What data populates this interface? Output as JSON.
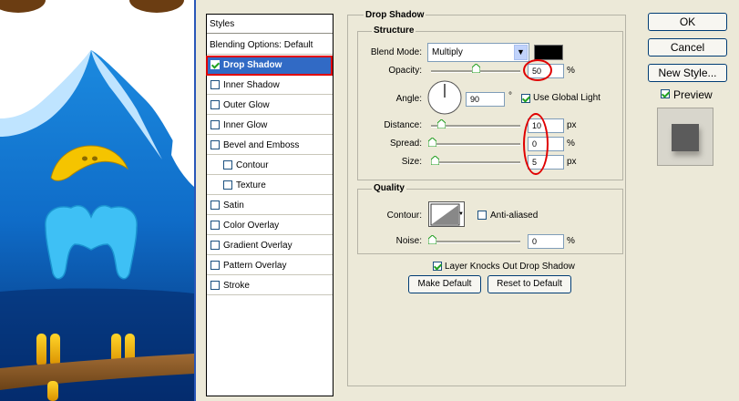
{
  "styles_list": {
    "header": "Styles",
    "items": [
      {
        "label": "Blending Options: Default",
        "has_checkbox": false,
        "checked": false,
        "selected": false,
        "indent": false
      },
      {
        "label": "Drop Shadow",
        "has_checkbox": true,
        "checked": true,
        "selected": true,
        "indent": false
      },
      {
        "label": "Inner Shadow",
        "has_checkbox": true,
        "checked": false,
        "selected": false,
        "indent": false
      },
      {
        "label": "Outer Glow",
        "has_checkbox": true,
        "checked": false,
        "selected": false,
        "indent": false
      },
      {
        "label": "Inner Glow",
        "has_checkbox": true,
        "checked": false,
        "selected": false,
        "indent": false
      },
      {
        "label": "Bevel and Emboss",
        "has_checkbox": true,
        "checked": false,
        "selected": false,
        "indent": false
      },
      {
        "label": "Contour",
        "has_checkbox": true,
        "checked": false,
        "selected": false,
        "indent": true
      },
      {
        "label": "Texture",
        "has_checkbox": true,
        "checked": false,
        "selected": false,
        "indent": true
      },
      {
        "label": "Satin",
        "has_checkbox": true,
        "checked": false,
        "selected": false,
        "indent": false
      },
      {
        "label": "Color Overlay",
        "has_checkbox": true,
        "checked": false,
        "selected": false,
        "indent": false
      },
      {
        "label": "Gradient Overlay",
        "has_checkbox": true,
        "checked": false,
        "selected": false,
        "indent": false
      },
      {
        "label": "Pattern Overlay",
        "has_checkbox": true,
        "checked": false,
        "selected": false,
        "indent": false
      },
      {
        "label": "Stroke",
        "has_checkbox": true,
        "checked": false,
        "selected": false,
        "indent": false
      }
    ]
  },
  "drop_shadow": {
    "title": "Drop Shadow",
    "structure": {
      "title": "Structure",
      "blend_mode_label": "Blend Mode:",
      "blend_mode_value": "Multiply",
      "shadow_color": "#000000",
      "opacity_label": "Opacity:",
      "opacity_value": "50",
      "opacity_unit": "%",
      "opacity_fraction": 0.5,
      "angle_label": "Angle:",
      "angle_value": "90",
      "angle_unit": "°",
      "use_global_light_label": "Use Global Light",
      "use_global_light_checked": true,
      "distance_label": "Distance:",
      "distance_value": "10",
      "distance_unit": "px",
      "spread_label": "Spread:",
      "spread_value": "0",
      "spread_unit": "%",
      "size_label": "Size:",
      "size_value": "5",
      "size_unit": "px"
    },
    "quality": {
      "title": "Quality",
      "contour_label": "Contour:",
      "anti_aliased_label": "Anti-aliased",
      "anti_aliased_checked": false,
      "noise_label": "Noise:",
      "noise_value": "0",
      "noise_unit": "%"
    },
    "knocks_out_label": "Layer Knocks Out Drop Shadow",
    "knocks_out_checked": true,
    "make_default_label": "Make Default",
    "reset_default_label": "Reset to Default"
  },
  "buttons": {
    "ok": "OK",
    "cancel": "Cancel",
    "new_style": "New Style...",
    "preview_label": "Preview",
    "preview_checked": true
  },
  "colors": {
    "selection_blue": "#316ac5",
    "highlight_red": "#e00000",
    "checkmark_green": "#21a121",
    "dialog_bg": "#ece9d8"
  }
}
